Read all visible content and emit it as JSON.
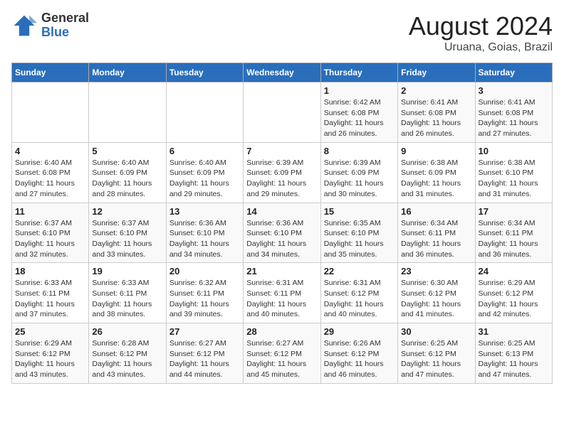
{
  "header": {
    "logo_line1": "General",
    "logo_line2": "Blue",
    "title": "August 2024",
    "subtitle": "Uruana, Goias, Brazil"
  },
  "calendar": {
    "days_of_week": [
      "Sunday",
      "Monday",
      "Tuesday",
      "Wednesday",
      "Thursday",
      "Friday",
      "Saturday"
    ],
    "weeks": [
      [
        {
          "day": "",
          "info": ""
        },
        {
          "day": "",
          "info": ""
        },
        {
          "day": "",
          "info": ""
        },
        {
          "day": "",
          "info": ""
        },
        {
          "day": "1",
          "info": "Sunrise: 6:42 AM\nSunset: 6:08 PM\nDaylight: 11 hours and 26 minutes."
        },
        {
          "day": "2",
          "info": "Sunrise: 6:41 AM\nSunset: 6:08 PM\nDaylight: 11 hours and 26 minutes."
        },
        {
          "day": "3",
          "info": "Sunrise: 6:41 AM\nSunset: 6:08 PM\nDaylight: 11 hours and 27 minutes."
        }
      ],
      [
        {
          "day": "4",
          "info": "Sunrise: 6:40 AM\nSunset: 6:08 PM\nDaylight: 11 hours and 27 minutes."
        },
        {
          "day": "5",
          "info": "Sunrise: 6:40 AM\nSunset: 6:09 PM\nDaylight: 11 hours and 28 minutes."
        },
        {
          "day": "6",
          "info": "Sunrise: 6:40 AM\nSunset: 6:09 PM\nDaylight: 11 hours and 29 minutes."
        },
        {
          "day": "7",
          "info": "Sunrise: 6:39 AM\nSunset: 6:09 PM\nDaylight: 11 hours and 29 minutes."
        },
        {
          "day": "8",
          "info": "Sunrise: 6:39 AM\nSunset: 6:09 PM\nDaylight: 11 hours and 30 minutes."
        },
        {
          "day": "9",
          "info": "Sunrise: 6:38 AM\nSunset: 6:09 PM\nDaylight: 11 hours and 31 minutes."
        },
        {
          "day": "10",
          "info": "Sunrise: 6:38 AM\nSunset: 6:10 PM\nDaylight: 11 hours and 31 minutes."
        }
      ],
      [
        {
          "day": "11",
          "info": "Sunrise: 6:37 AM\nSunset: 6:10 PM\nDaylight: 11 hours and 32 minutes."
        },
        {
          "day": "12",
          "info": "Sunrise: 6:37 AM\nSunset: 6:10 PM\nDaylight: 11 hours and 33 minutes."
        },
        {
          "day": "13",
          "info": "Sunrise: 6:36 AM\nSunset: 6:10 PM\nDaylight: 11 hours and 34 minutes."
        },
        {
          "day": "14",
          "info": "Sunrise: 6:36 AM\nSunset: 6:10 PM\nDaylight: 11 hours and 34 minutes."
        },
        {
          "day": "15",
          "info": "Sunrise: 6:35 AM\nSunset: 6:10 PM\nDaylight: 11 hours and 35 minutes."
        },
        {
          "day": "16",
          "info": "Sunrise: 6:34 AM\nSunset: 6:11 PM\nDaylight: 11 hours and 36 minutes."
        },
        {
          "day": "17",
          "info": "Sunrise: 6:34 AM\nSunset: 6:11 PM\nDaylight: 11 hours and 36 minutes."
        }
      ],
      [
        {
          "day": "18",
          "info": "Sunrise: 6:33 AM\nSunset: 6:11 PM\nDaylight: 11 hours and 37 minutes."
        },
        {
          "day": "19",
          "info": "Sunrise: 6:33 AM\nSunset: 6:11 PM\nDaylight: 11 hours and 38 minutes."
        },
        {
          "day": "20",
          "info": "Sunrise: 6:32 AM\nSunset: 6:11 PM\nDaylight: 11 hours and 39 minutes."
        },
        {
          "day": "21",
          "info": "Sunrise: 6:31 AM\nSunset: 6:11 PM\nDaylight: 11 hours and 40 minutes."
        },
        {
          "day": "22",
          "info": "Sunrise: 6:31 AM\nSunset: 6:12 PM\nDaylight: 11 hours and 40 minutes."
        },
        {
          "day": "23",
          "info": "Sunrise: 6:30 AM\nSunset: 6:12 PM\nDaylight: 11 hours and 41 minutes."
        },
        {
          "day": "24",
          "info": "Sunrise: 6:29 AM\nSunset: 6:12 PM\nDaylight: 11 hours and 42 minutes."
        }
      ],
      [
        {
          "day": "25",
          "info": "Sunrise: 6:29 AM\nSunset: 6:12 PM\nDaylight: 11 hours and 43 minutes."
        },
        {
          "day": "26",
          "info": "Sunrise: 6:28 AM\nSunset: 6:12 PM\nDaylight: 11 hours and 43 minutes."
        },
        {
          "day": "27",
          "info": "Sunrise: 6:27 AM\nSunset: 6:12 PM\nDaylight: 11 hours and 44 minutes."
        },
        {
          "day": "28",
          "info": "Sunrise: 6:27 AM\nSunset: 6:12 PM\nDaylight: 11 hours and 45 minutes."
        },
        {
          "day": "29",
          "info": "Sunrise: 6:26 AM\nSunset: 6:12 PM\nDaylight: 11 hours and 46 minutes."
        },
        {
          "day": "30",
          "info": "Sunrise: 6:25 AM\nSunset: 6:12 PM\nDaylight: 11 hours and 47 minutes."
        },
        {
          "day": "31",
          "info": "Sunrise: 6:25 AM\nSunset: 6:13 PM\nDaylight: 11 hours and 47 minutes."
        }
      ]
    ]
  }
}
